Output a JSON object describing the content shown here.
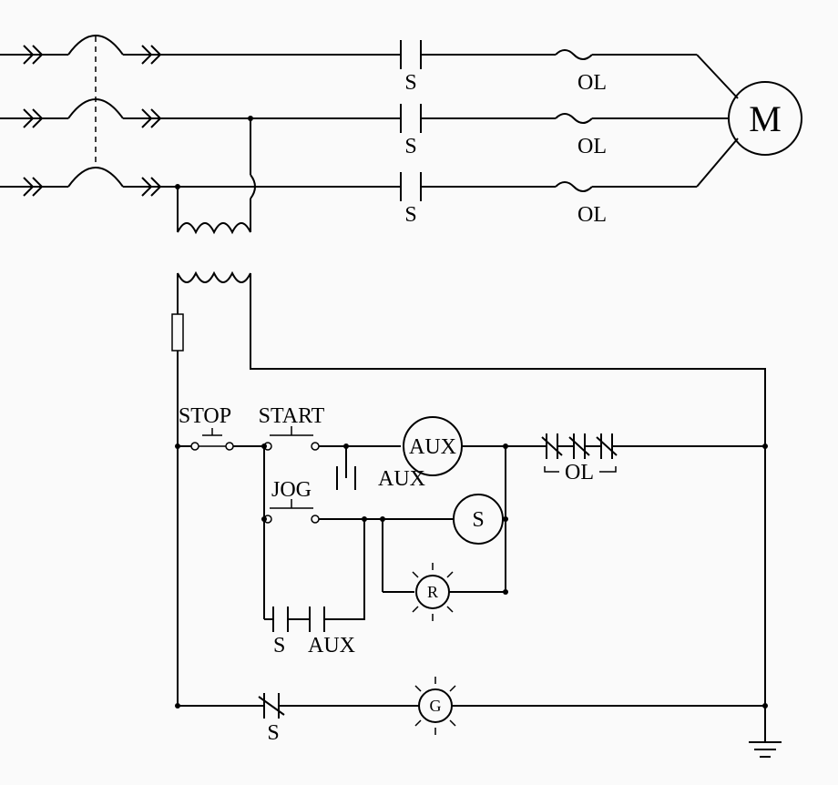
{
  "power": {
    "contact_label": "S",
    "overload_label": "OL",
    "motor_label": "M"
  },
  "control": {
    "stop_label": "STOP",
    "start_label": "START",
    "jog_label": "JOG",
    "aux_relay_label": "AUX",
    "aux_contact_label": "AUX",
    "s_coil_label": "S",
    "r_lamp_label": "R",
    "g_lamp_label": "G",
    "s_seal_label": "S",
    "aux_seal_label": "AUX",
    "ol_contacts_label": "OL",
    "s_nc_label": "S"
  }
}
